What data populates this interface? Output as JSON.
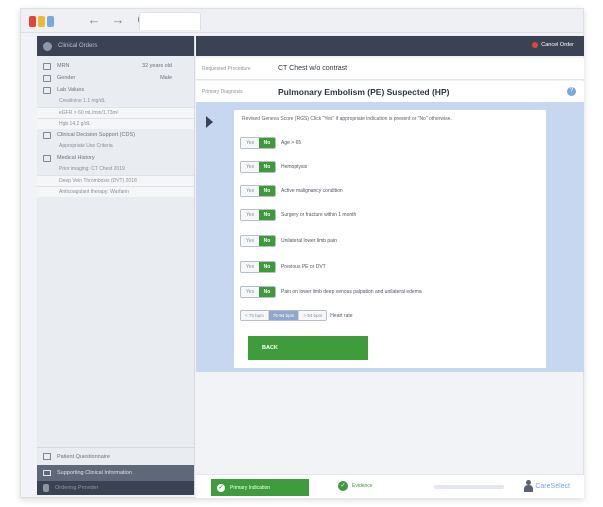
{
  "browser": {
    "nav": {
      "back": "←",
      "forward": "→",
      "reload": "C"
    },
    "logo_colors": [
      "#e0453a",
      "#f2b632",
      "#7aa8e0"
    ]
  },
  "sidebar": {
    "header_label": "Clinical Orders",
    "rows": [
      {
        "label": "MRN",
        "value": "32 years old",
        "icon": "id-icon"
      },
      {
        "label": "Gender",
        "value": "Male",
        "icon": "gender-icon"
      },
      {
        "label": "Lab Values",
        "value": "",
        "icon": "lab-icon"
      }
    ],
    "lab_items": [
      "Creatinine 1.1 mg/dL",
      "eGFR > 60 mL/min/1.73m²",
      "Hgb 14.2 g/dL"
    ],
    "section2": {
      "label": "Clinical Decision Support (CDS)",
      "icon": "cds-icon"
    },
    "section2_items": [
      "Appropriate Use Criteria"
    ],
    "section3": {
      "label": "Medical History",
      "icon": "history-icon"
    },
    "section3_items": [
      "Prior imaging: CT Chest 2019",
      "Deep Vein Thrombosis (DVT) 2018",
      "Anticoagulant therapy: Warfarin"
    ],
    "bottom1": "Patient Questionnaire",
    "bottom2": "Supporting Clinical Information",
    "bottom3": "Ordering Provider"
  },
  "topbar": {
    "cancel_label": "Cancel Order"
  },
  "order": {
    "requested_label": "Requested Procedure",
    "requested_value": "CT Chest w/o contrast",
    "diagnosis_label": "Primary Diagnosis",
    "diagnosis_value": "Pulmonary Embolism (PE) Suspected (HP)",
    "help": "?"
  },
  "criteria": {
    "title": "Revised Geneva Score (RGS) Click \"Yes\" if appropriate indication is present or \"No\" otherwise.",
    "items": [
      {
        "yes": "Yes",
        "no": "No",
        "label": "Age > 65"
      },
      {
        "yes": "Yes",
        "no": "No",
        "label": "Hemoptysis"
      },
      {
        "yes": "Yes",
        "no": "No",
        "label": "Active malignancy condition"
      },
      {
        "yes": "Yes",
        "no": "No",
        "label": "Surgery or fracture within 1 month"
      },
      {
        "yes": "Yes",
        "no": "No",
        "label": "Unilateral lower limb pain"
      },
      {
        "yes": "Yes",
        "no": "No",
        "label": "Previous PE or DVT"
      },
      {
        "yes": "Yes",
        "no": "No",
        "label": "Pain on lower limb deep venous palpation and unilateral edema"
      }
    ],
    "heart_rate_options": [
      "< 75 bpm",
      "75-94 bpm",
      "> 94 bpm"
    ],
    "heart_rate_selected": 1,
    "heart_rate_label": "Heart rate",
    "back_label": "BACK"
  },
  "footer": {
    "primary_label": "Primary Indication",
    "secondary_label": "Evidence",
    "brand": "CareSelect"
  }
}
